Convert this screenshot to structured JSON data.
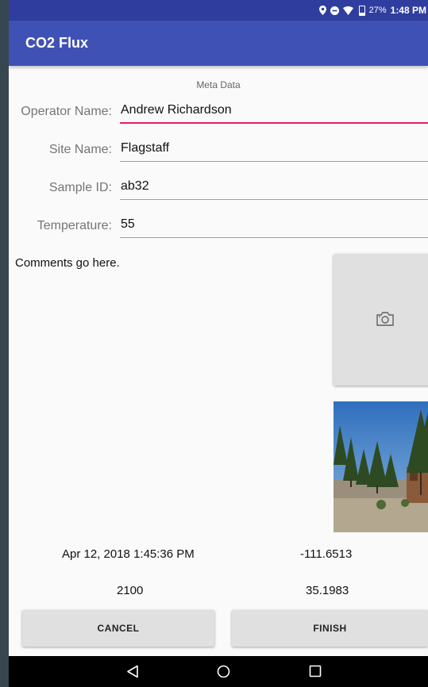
{
  "status_bar": {
    "battery": "27%",
    "time": "1:48 PM",
    "icons": [
      "location-icon",
      "do-not-disturb-icon",
      "wifi-icon",
      "battery-icon"
    ]
  },
  "app_bar": {
    "title": "CO2 Flux",
    "color": "#3f51b5"
  },
  "form": {
    "section_title": "Meta Data",
    "fields": [
      {
        "label": "Operator Name:",
        "value": "Andrew Richardson"
      },
      {
        "label": "Site Name:",
        "value": "Flagstaff"
      },
      {
        "label": "Sample ID:",
        "value": "ab32"
      },
      {
        "label": "Temperature:",
        "value": "55"
      }
    ],
    "comments": "Comments go here.",
    "focus_color": "#e91e63"
  },
  "media": {
    "camera_icon": "camera-icon"
  },
  "info": {
    "datetime": "Apr 12, 2018 1:45:36 PM",
    "longitude": "-111.6513",
    "value": "2100",
    "latitude": "35.1983"
  },
  "buttons": {
    "cancel": "CANCEL",
    "finish": "FINISH"
  },
  "nav_bar": {
    "icons": [
      "back-icon",
      "home-icon",
      "recents-icon"
    ]
  }
}
